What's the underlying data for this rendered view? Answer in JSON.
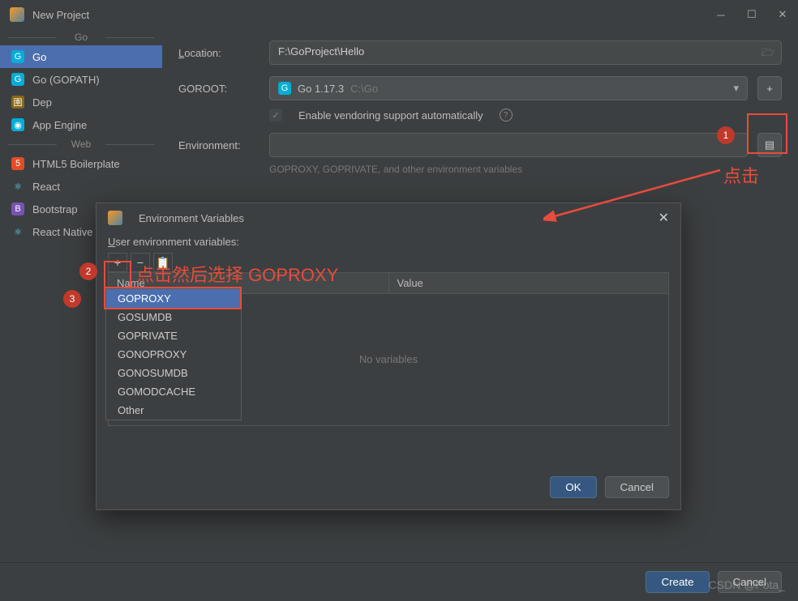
{
  "titlebar": {
    "title": "New Project"
  },
  "sidebar": {
    "section1": "Go",
    "section2": "Web",
    "items": [
      {
        "label": "Go",
        "icon": "go"
      },
      {
        "label": "Go (GOPATH)",
        "icon": "go"
      },
      {
        "label": "Dep",
        "icon": "dep"
      },
      {
        "label": "App Engine",
        "icon": "go"
      },
      {
        "label": "HTML5 Boilerplate",
        "icon": "html5"
      },
      {
        "label": "React",
        "icon": "react"
      },
      {
        "label": "Bootstrap",
        "icon": "bootstrap"
      },
      {
        "label": "React Native",
        "icon": "react"
      }
    ]
  },
  "form": {
    "location_label": "Location:",
    "location_value": "F:\\GoProject\\Hello",
    "goroot_label": "GOROOT:",
    "goroot_value": "Go 1.17.3",
    "goroot_path": " C:\\Go",
    "vendoring_label": "Enable vendoring support automatically",
    "environment_label": "Environment:",
    "environment_value": "",
    "hint": "GOPROXY, GOPRIVATE, and other environment variables"
  },
  "dialog": {
    "title": "Environment Variables",
    "section_label": "User environment variables:",
    "col_name": "Name",
    "col_value": "Value",
    "empty_text": "No variables",
    "ok_label": "OK",
    "cancel_label": "Cancel"
  },
  "popup": {
    "items": [
      "GOPROXY",
      "GOSUMDB",
      "GOPRIVATE",
      "GONOPROXY",
      "GONOSUMDB",
      "GOMODCACHE",
      "Other"
    ]
  },
  "footer": {
    "create_label": "Create",
    "cancel_label": "Cancel"
  },
  "annotations": {
    "note1": "点击",
    "note2": "点击然后选择 GOPROXY",
    "badge1": "1",
    "badge2": "2",
    "badge3": "3"
  },
  "watermark": "CSDN @Pota_"
}
